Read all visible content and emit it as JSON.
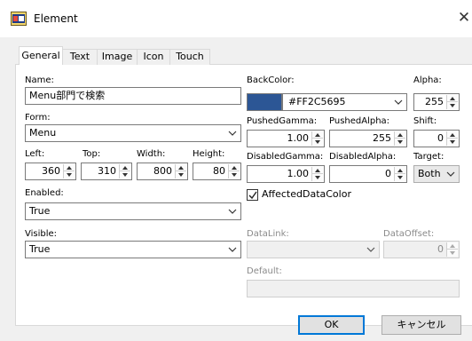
{
  "window": {
    "title": "Element",
    "close_glyph": "✕",
    "icon": "app-icon"
  },
  "tabs": [
    {
      "label": "General",
      "active": true
    },
    {
      "label": "Text"
    },
    {
      "label": "Image"
    },
    {
      "label": "Icon"
    },
    {
      "label": "Touch"
    }
  ],
  "general": {
    "name": {
      "label": "Name:",
      "value": "Menu部門で検索"
    },
    "form": {
      "label": "Form:",
      "value": "Menu"
    },
    "left": {
      "label": "Left:",
      "value": "360"
    },
    "top": {
      "label": "Top:",
      "value": "310"
    },
    "width": {
      "label": "Width:",
      "value": "800"
    },
    "height": {
      "label": "Height:",
      "value": "80"
    },
    "enabled": {
      "label": "Enabled:",
      "value": "True"
    },
    "visible": {
      "label": "Visible:",
      "value": "True"
    },
    "backcolor": {
      "label": "BackColor:",
      "value": "#FF2C5695",
      "swatch": "#2C5695"
    },
    "alpha": {
      "label": "Alpha:",
      "value": "255"
    },
    "pushed_gamma": {
      "label": "PushedGamma:",
      "value": "1.00"
    },
    "pushed_alpha": {
      "label": "PushedAlpha:",
      "value": "255"
    },
    "shift": {
      "label": "Shift:",
      "value": "0"
    },
    "disabled_gamma": {
      "label": "DisabledGamma:",
      "value": "1.00"
    },
    "disabled_alpha": {
      "label": "DisabledAlpha:",
      "value": "0"
    },
    "target": {
      "label": "Target:",
      "value": "Both"
    },
    "affected_data_color": {
      "label": "AffectedDataColor",
      "checked": true
    },
    "data_link": {
      "label": "DataLink:",
      "value": ""
    },
    "data_offset": {
      "label": "DataOffset:",
      "value": "0"
    },
    "default": {
      "label": "Default:",
      "value": ""
    }
  },
  "buttons": {
    "ok": "OK",
    "cancel": "キャンセル"
  },
  "colors": {
    "accent": "#0078D7",
    "swatch": "#2C5695"
  }
}
